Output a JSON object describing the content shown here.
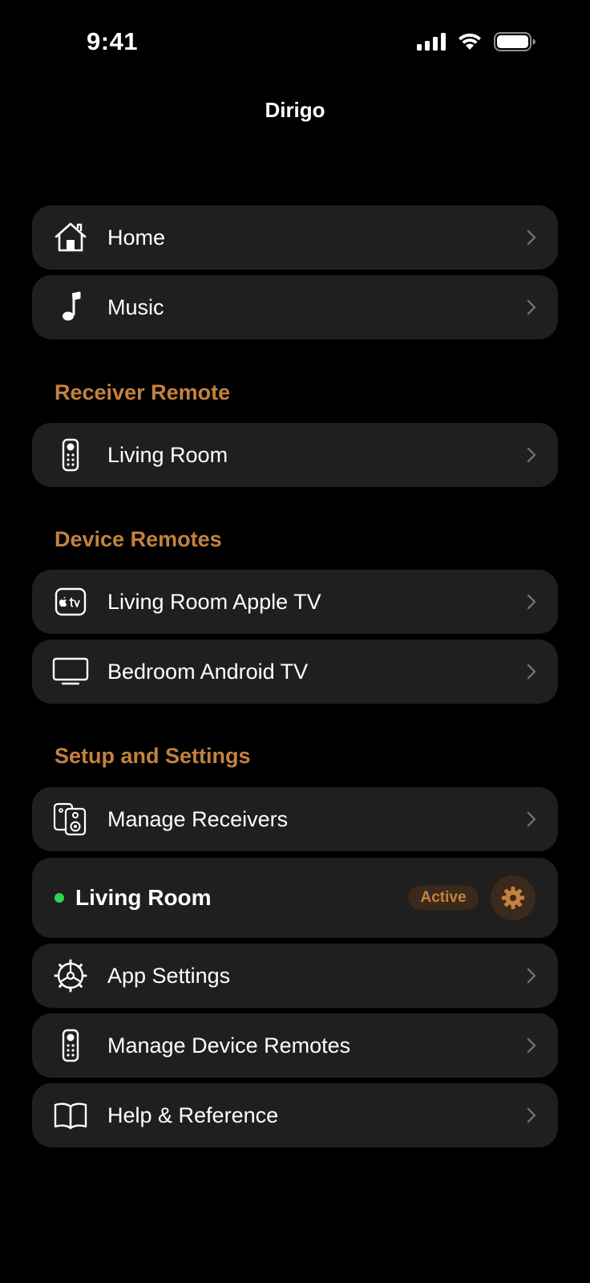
{
  "status": {
    "time": "9:41"
  },
  "nav": {
    "title": "Dirigo"
  },
  "top_items": [
    {
      "label": "Home",
      "icon": "home-icon"
    },
    {
      "label": "Music",
      "icon": "music-note-icon"
    }
  ],
  "receiver_remote": {
    "header": "Receiver Remote",
    "items": [
      {
        "label": "Living Room",
        "icon": "remote-icon"
      }
    ]
  },
  "device_remotes": {
    "header": "Device Remotes",
    "items": [
      {
        "label": "Living Room Apple TV",
        "icon": "apple-tv-icon"
      },
      {
        "label": "Bedroom Android TV",
        "icon": "tv-icon"
      }
    ]
  },
  "setup": {
    "header": "Setup and Settings",
    "manage_receivers": {
      "label": "Manage Receivers",
      "icon": "speakers-icon"
    },
    "active_receiver": {
      "name": "Living Room",
      "badge": "Active",
      "status_color": "#30d158"
    },
    "items": [
      {
        "label": "App Settings",
        "icon": "settings-icon"
      },
      {
        "label": "Manage Device Remotes",
        "icon": "remote-icon"
      },
      {
        "label": "Help & Reference",
        "icon": "book-icon"
      }
    ]
  },
  "colors": {
    "accent": "#c4813f",
    "row_bg": "#1f1f1f",
    "background": "#000000"
  }
}
